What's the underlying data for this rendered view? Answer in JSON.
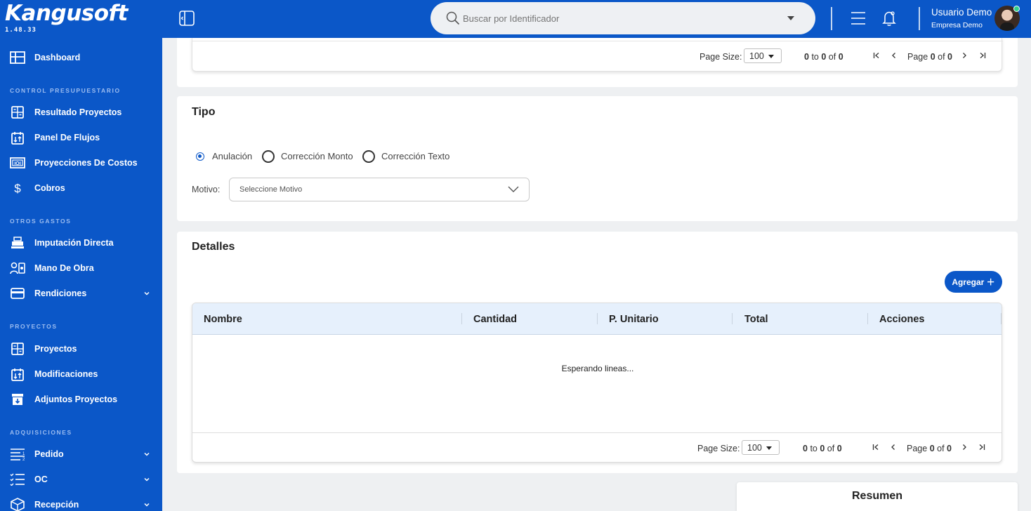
{
  "app": {
    "brand": "Kangusoft",
    "version": "1.48.33"
  },
  "sidebar": {
    "items": [
      {
        "label": "Dashboard",
        "icon": "dashboard-icon"
      },
      {
        "section": "CONTROL PRESUPUESTARIO"
      },
      {
        "label": "Resultado Proyectos",
        "icon": "calculator-icon"
      },
      {
        "label": "Panel De Flujos",
        "icon": "calendar-flow-icon"
      },
      {
        "label": "Proyecciones De Costos",
        "icon": "money-icon"
      },
      {
        "label": "Cobros",
        "icon": "dollar-icon"
      },
      {
        "section": "OTROS GASTOS"
      },
      {
        "label": "Imputación Directa",
        "icon": "cash-register-icon"
      },
      {
        "label": "Mano De Obra",
        "icon": "workers-icon"
      },
      {
        "label": "Rendiciones",
        "icon": "card-icon",
        "expandable": true
      },
      {
        "section": "PROYECTOS"
      },
      {
        "label": "Proyectos",
        "icon": "calculator-icon"
      },
      {
        "label": "Modificaciones",
        "icon": "calendar-flow-icon"
      },
      {
        "label": "Adjuntos Proyectos",
        "icon": "archive-icon"
      },
      {
        "section": "ADQUISICIONES"
      },
      {
        "label": "Pedido",
        "icon": "list-icon",
        "expandable": true
      },
      {
        "label": "OC",
        "icon": "checklist-icon",
        "expandable": true
      },
      {
        "label": "Recepción",
        "icon": "box-icon",
        "expandable": true
      }
    ]
  },
  "topbar": {
    "search_placeholder": "Buscar por Identificador",
    "user_name": "Usuario Demo",
    "company": "Empresa Demo"
  },
  "top_pager": {
    "page_size_label": "Page Size:",
    "page_size": "100",
    "from": "0",
    "to_word": "to",
    "to": "0",
    "of_word": "of",
    "total": "0",
    "page_word": "Page",
    "page": "0",
    "pages": "0"
  },
  "tipo": {
    "title": "Tipo",
    "options": [
      "Anulación",
      "Corrección Monto",
      "Corrección Texto"
    ],
    "selected": "Anulación",
    "motivo_label": "Motivo:",
    "motivo_placeholder": "Seleccione Motivo"
  },
  "detalles": {
    "title": "Detalles",
    "add_button": "Agregar ＋",
    "columns": [
      "Nombre",
      "Cantidad",
      "P. Unitario",
      "Total",
      "Acciones"
    ],
    "empty_message": "Esperando lineas...",
    "pager": {
      "page_size_label": "Page Size:",
      "page_size": "100",
      "from": "0",
      "to_word": "to",
      "to": "0",
      "of_word": "of",
      "total": "0",
      "page_word": "Page",
      "page": "0",
      "pages": "0"
    }
  },
  "resumen": {
    "title": "Resumen"
  },
  "colors": {
    "primary": "#0b57c8",
    "grid_header": "#e6f0fc",
    "online": "#2fd08c"
  }
}
